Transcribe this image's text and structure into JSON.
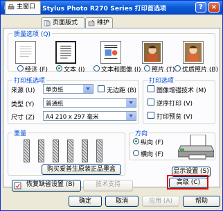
{
  "window": {
    "title": "EPSON Stylus Photo R270 Series 打印首选项",
    "help_glyph": "?",
    "close_glyph": "×"
  },
  "tabs": [
    {
      "label": "主窗口",
      "icon": "printer-tab-icon"
    },
    {
      "label": "页面版式",
      "icon": "page-layout-tab-icon"
    },
    {
      "label": "维护",
      "icon": "maintenance-tab-icon"
    }
  ],
  "quality": {
    "title": "质量选项 (Q)",
    "options": [
      {
        "label": "经济 (F)",
        "selected": false
      },
      {
        "label": "文本 (I)",
        "selected": true
      },
      {
        "label": "文本和图像 (I)",
        "selected": false
      },
      {
        "label": "照片 (T)",
        "selected": false
      },
      {
        "label": "优质照片 (B)",
        "selected": false
      }
    ]
  },
  "paper": {
    "title": "打印纸选项",
    "source_label": "来源 (U)",
    "source_value": "单页纸",
    "borderless_label": "无边距 (B)",
    "type_label": "类型 (Y)",
    "type_value": "普通纸",
    "size_label": "尺寸 (Z)",
    "size_value": "A4 210 x 297 毫米"
  },
  "print_options": {
    "title": "打印选项",
    "items": [
      "图像增强技术 (M)",
      "逆序打印 (V)",
      "打印预览 (V)"
    ]
  },
  "ink": {
    "title": "墨量",
    "buy_label": "购买爱普生原装正品墨盒",
    "cartridge_count": 6
  },
  "orientation": {
    "title": "方向",
    "portrait_label": "纵向 (F)",
    "landscape_label": "横向 (F)",
    "selected": "portrait"
  },
  "actions": {
    "restore_label": "恢复缺省设置 (B)",
    "tech_support_label": "技术支持",
    "show_settings_label": "显示设置 (S)",
    "advanced_label": "高级 (C)"
  },
  "footer": {
    "ok": "确定",
    "cancel": "取消",
    "apply": "应用 (A)",
    "help": "帮助"
  }
}
